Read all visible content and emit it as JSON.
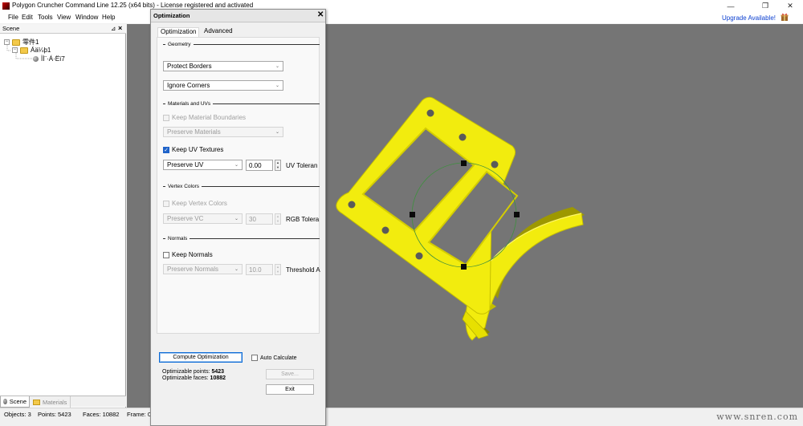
{
  "window": {
    "title": "Polygon Cruncher Command Line 12.25 (x64 bits) - License registered and activated",
    "min_glyph": "—",
    "max_glyph": "❐",
    "close_glyph": "✕"
  },
  "menu": [
    "File",
    "Edit",
    "Tools",
    "View",
    "Window",
    "Help"
  ],
  "upgrade_link": "Upgrade Available!",
  "scene_panel": {
    "header": "Scene",
    "pin_glyph": "⊿",
    "close_glyph": "×",
    "tree": [
      {
        "label": "零件1",
        "expander": "−"
      },
      {
        "label": "Áä¼þ1",
        "expander": "−"
      },
      {
        "label": "ÌÌ¨·Á·Ëï7"
      }
    ]
  },
  "bottom_tabs": {
    "scene": "Scene",
    "materials": "Materials"
  },
  "status": {
    "objects": "Objects: 3",
    "points": "Points: 5423",
    "faces": "Faces: 10882",
    "frame": "Frame: 0/"
  },
  "watermark": "www.snren.com",
  "dialog": {
    "title": "Optimization",
    "close_glyph": "✕",
    "tabs": [
      "Optimization",
      "Advanced"
    ],
    "geometry": {
      "group": "Geometry",
      "borders": "Protect Borders",
      "corners": "Ignore Corners"
    },
    "materials": {
      "group": "Materials and UVs",
      "keep_boundaries": "Keep Material Boundaries",
      "preserve_materials": "Preserve Materials",
      "keep_uv": "Keep UV Textures",
      "preserve_uv": "Preserve UV",
      "uv_value": "0.00",
      "uv_label": "UV Toleran"
    },
    "vertex_colors": {
      "group": "Vertex Colors",
      "keep_vc": "Keep Vertex Colors",
      "preserve_vc": "Preserve VC",
      "rgb_value": "30",
      "rgb_label": "RGB Tolera"
    },
    "normals": {
      "group": "Normals",
      "keep_normals": "Keep Normals",
      "preserve_normals": "Preserve Normals",
      "threshold_value": "10.0",
      "threshold_label": "Threshold A"
    },
    "compute_button": "Compute Optimization",
    "auto_calculate": "Auto Calculate",
    "points_label": "Optimizable points:",
    "points_value": "5423",
    "faces_label": "Optimizable faces:",
    "faces_value": "10882",
    "save_button": "Save...",
    "exit_button": "Exit"
  },
  "colors": {
    "model": "#f2ec0e",
    "model_shadow": "#b8b300",
    "viewport": "#757575",
    "accent": "#1f63c9"
  }
}
